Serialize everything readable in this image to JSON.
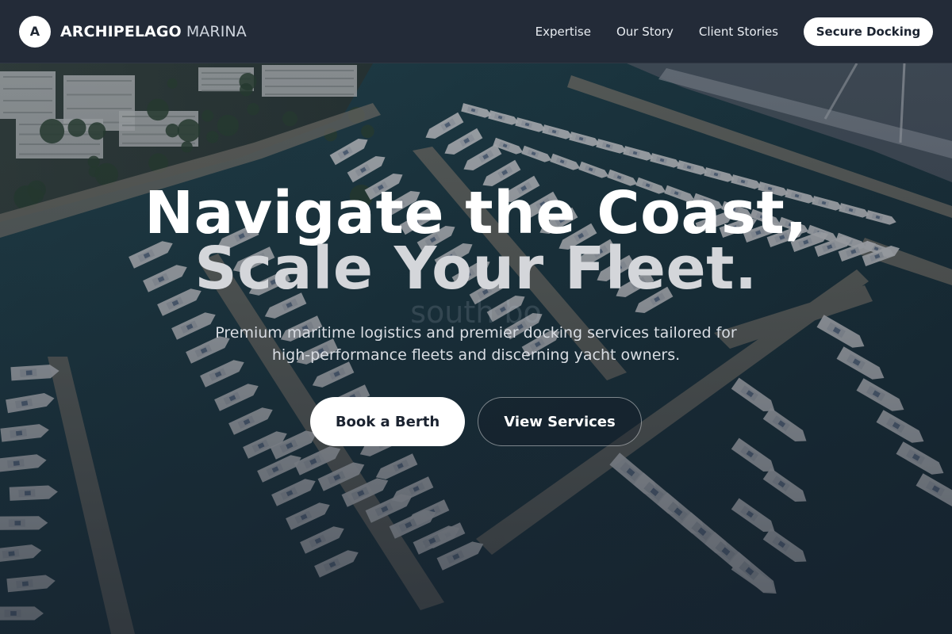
{
  "brand": {
    "mark": "A",
    "name_strong": "ARCHIPELAGO",
    "name_light": "MARINA"
  },
  "nav": {
    "links": [
      {
        "label": "Expertise"
      },
      {
        "label": "Our Story"
      },
      {
        "label": "Client Stories"
      }
    ],
    "cta_label": "Secure Docking"
  },
  "hero": {
    "title_line_1": "Navigate the Coast,",
    "title_line_2": "Scale Your Fleet.",
    "ghost_text": "south bo",
    "subtitle": "Premium maritime logistics and premier docking services tailored for high-performance fleets and discerning yacht owners.",
    "primary_button": "Book a Berth",
    "secondary_button": "View Services"
  },
  "colors": {
    "navbar_bg": "#232b38",
    "water": "#1d3a44",
    "button_light": "#ffffff",
    "text_dark": "#1b2330"
  }
}
